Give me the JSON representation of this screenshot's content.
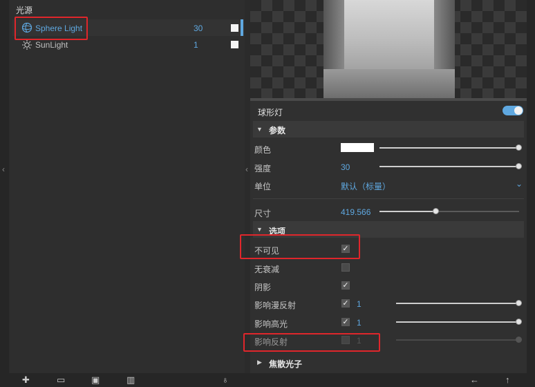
{
  "lights_panel": {
    "section_title": "光源",
    "items": [
      {
        "name": "Sphere Light",
        "value": "30",
        "icon": "sphere-light-icon",
        "selected": true
      },
      {
        "name": "SunLight",
        "value": "1",
        "icon": "sun-icon",
        "selected": false
      }
    ]
  },
  "properties": {
    "title": "球形灯",
    "toggle_on": true,
    "params_header": "参数",
    "color_label": "颜色",
    "color_value": "#ffffff",
    "intensity_label": "强度",
    "intensity_value": "30",
    "unit_label": "单位",
    "unit_value": "默认（标量）",
    "size_label": "尺寸",
    "size_value": "419.566",
    "size_level": 0.4,
    "options_header": "选项",
    "invisible_label": "不可见",
    "invisible_checked": true,
    "no_decay_label": "无衰减",
    "no_decay_checked": false,
    "shadow_label": "阴影",
    "shadow_checked": true,
    "diffuse_label": "影响漫反射",
    "diffuse_value": "1",
    "diffuse_checked": true,
    "specular_label": "影响高光",
    "specular_value": "1",
    "specular_checked": true,
    "reflection_label": "影响反射",
    "reflection_value": "1",
    "reflection_checked": false,
    "caustics_header": "焦散光子"
  },
  "toolbar_icons": [
    "add-light-icon",
    "open-folder-icon",
    "save-icon",
    "delete-icon",
    "lamp-icon",
    "arrow-left-icon",
    "arrow-up-icon"
  ],
  "colors": {
    "accent": "#5fa8e0",
    "highlight_box": "#e0262b"
  }
}
